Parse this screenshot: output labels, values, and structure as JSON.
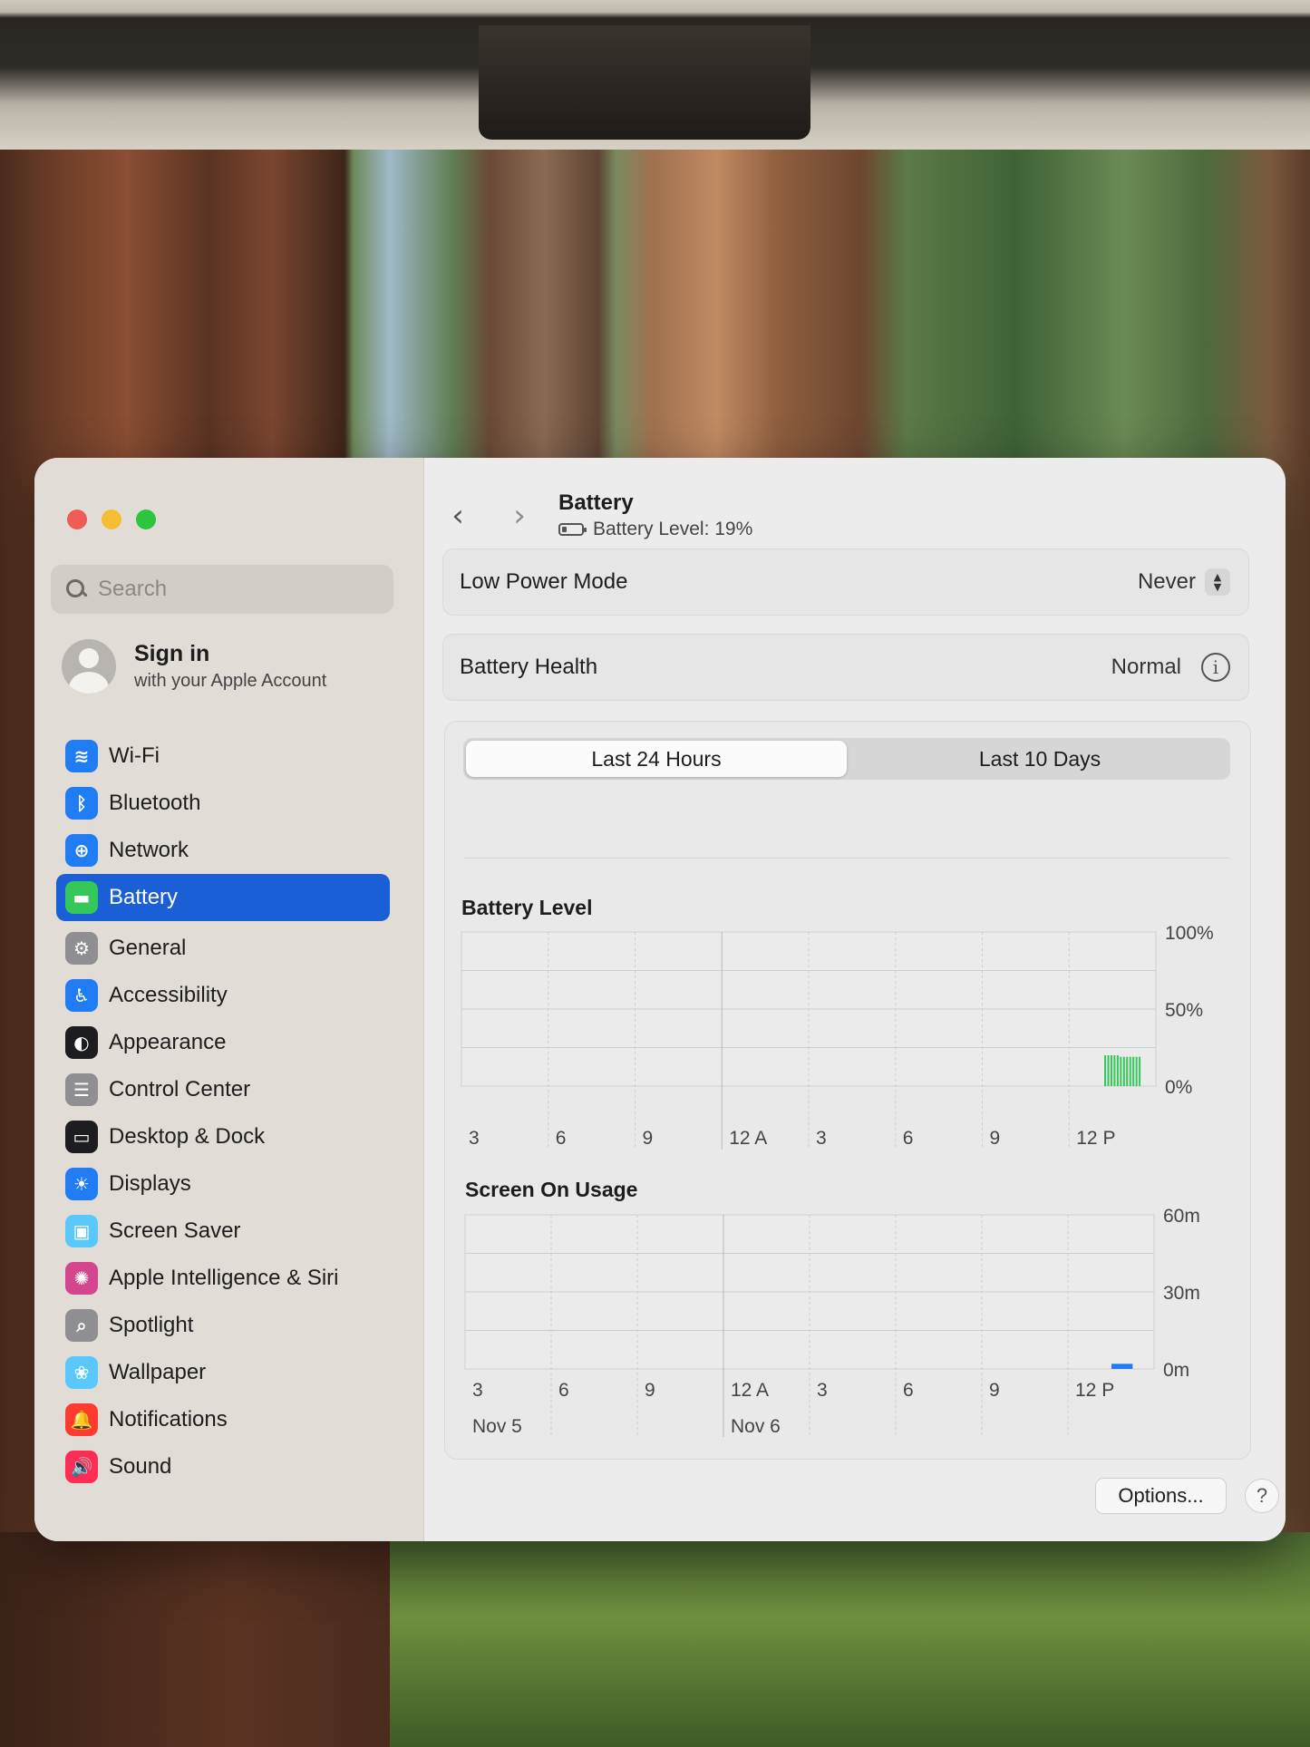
{
  "window": {
    "search_placeholder": "Search",
    "signin": {
      "title": "Sign in",
      "subtitle": "with your Apple Account"
    },
    "sidebar_groups": [
      [
        {
          "label": "Wi-Fi",
          "icon": "wifi-icon",
          "glyph": "≋",
          "color": "#1f7cf2",
          "active": false
        },
        {
          "label": "Bluetooth",
          "icon": "bluetooth-icon",
          "glyph": "ᛒ",
          "color": "#1f7cf2",
          "active": false
        },
        {
          "label": "Network",
          "icon": "network-globe-icon",
          "glyph": "⊕",
          "color": "#1f7cf2",
          "active": false
        },
        {
          "label": "Battery",
          "icon": "battery-icon",
          "glyph": "▬",
          "color": "#34c759",
          "active": true
        }
      ],
      [
        {
          "label": "General",
          "icon": "gear-icon",
          "glyph": "⚙",
          "color": "#8e8e93",
          "active": false
        },
        {
          "label": "Accessibility",
          "icon": "accessibility-icon",
          "glyph": "♿",
          "color": "#1f7cf2",
          "active": false
        },
        {
          "label": "Appearance",
          "icon": "appearance-icon",
          "glyph": "◐",
          "color": "#1d1d1f",
          "active": false
        },
        {
          "label": "Control Center",
          "icon": "control-center-icon",
          "glyph": "☰",
          "color": "#8e8e93",
          "active": false
        },
        {
          "label": "Desktop & Dock",
          "icon": "desktop-dock-icon",
          "glyph": "▭",
          "color": "#1d1d1f",
          "active": false
        },
        {
          "label": "Displays",
          "icon": "displays-icon",
          "glyph": "☀",
          "color": "#1f7cf2",
          "active": false
        },
        {
          "label": "Screen Saver",
          "icon": "screen-saver-icon",
          "glyph": "▣",
          "color": "#5ac8fa",
          "active": false
        },
        {
          "label": "Apple Intelligence & Siri",
          "icon": "siri-icon",
          "glyph": "✺",
          "color": "#d4478f",
          "active": false
        },
        {
          "label": "Spotlight",
          "icon": "spotlight-icon",
          "glyph": "⌕",
          "color": "#8e8e93",
          "active": false
        },
        {
          "label": "Wallpaper",
          "icon": "wallpaper-icon",
          "glyph": "❀",
          "color": "#5ac8fa",
          "active": false
        }
      ],
      [
        {
          "label": "Notifications",
          "icon": "notifications-bell-icon",
          "glyph": "🔔",
          "color": "#ff3b30",
          "active": false
        },
        {
          "label": "Sound",
          "icon": "speaker-icon",
          "glyph": "🔊",
          "color": "#ff2d55",
          "active": false
        }
      ]
    ]
  },
  "main": {
    "title": "Battery",
    "subtitle": "Battery Level: 19%",
    "low_power": {
      "label": "Low Power Mode",
      "value": "Never"
    },
    "health": {
      "label": "Battery Health",
      "value": "Normal"
    },
    "tabs": [
      {
        "label": "Last 24 Hours",
        "selected": true
      },
      {
        "label": "Last 10 Days",
        "selected": false
      }
    ],
    "options_label": "Options...",
    "help_label": "?"
  },
  "chart_data": [
    {
      "type": "bar",
      "title": "Battery Level",
      "x_tick_labels": [
        "3",
        "6",
        "9",
        "12 A",
        "3",
        "6",
        "9",
        "12 P"
      ],
      "y_tick_labels": [
        "100%",
        "50%",
        "0%"
      ],
      "ylim": [
        0,
        100
      ],
      "bar_color": "#34c759",
      "series": [
        {
          "values": [
            20,
            20,
            20,
            20,
            20,
            19,
            19,
            19,
            19,
            19,
            19,
            19
          ],
          "x_start_hours": 22.2,
          "x_end_hours": 23.5
        }
      ],
      "x_range_hours": [
        0,
        24
      ]
    },
    {
      "type": "bar",
      "title": "Screen On Usage",
      "x_tick_labels": [
        "3",
        "6",
        "9",
        "12 A",
        "3",
        "6",
        "9",
        "12 P"
      ],
      "date_labels": [
        "Nov 5",
        "Nov 6"
      ],
      "y_tick_labels": [
        "60m",
        "30m",
        "0m"
      ],
      "ylim": [
        0,
        60
      ],
      "bar_color": "#1f7cf2",
      "series": [
        {
          "values": [
            2
          ],
          "x_start_hours": 22.5,
          "x_end_hours": 23.3
        }
      ],
      "x_range_hours": [
        0,
        24
      ]
    }
  ]
}
